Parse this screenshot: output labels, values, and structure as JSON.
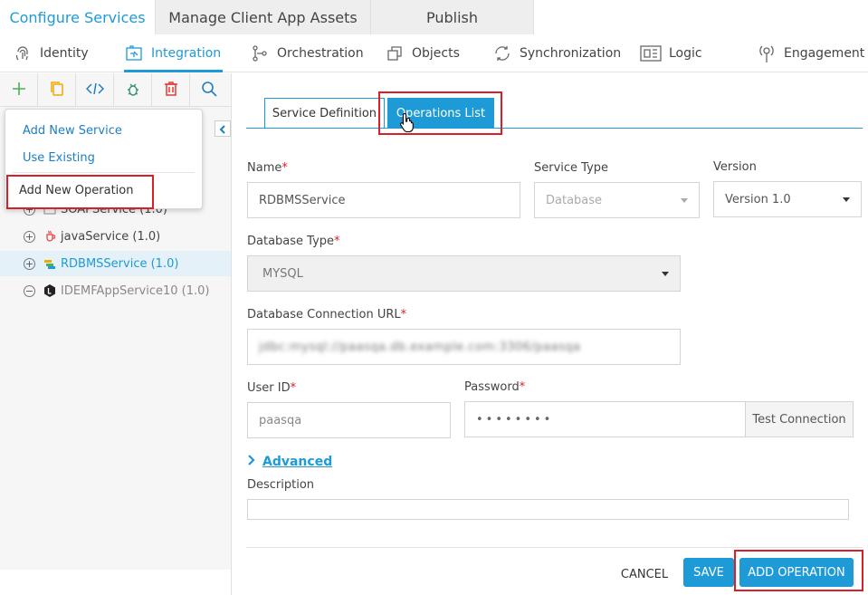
{
  "top_tabs": [
    {
      "label": "Configure Services"
    },
    {
      "label": "Manage Client App Assets"
    },
    {
      "label": "Publish"
    }
  ],
  "sub_nav": [
    {
      "label": "Identity",
      "icon": "fingerprint-icon"
    },
    {
      "label": "Integration",
      "icon": "integration-icon"
    },
    {
      "label": "Orchestration",
      "icon": "orchestration-icon"
    },
    {
      "label": "Objects",
      "icon": "objects-icon"
    },
    {
      "label": "Synchronization",
      "icon": "sync-icon"
    },
    {
      "label": "Logic",
      "icon": "logic-icon"
    },
    {
      "label": "Engagement",
      "icon": "engagement-icon"
    }
  ],
  "menu": {
    "add_new_service": "Add New Service",
    "use_existing": "Use Existing",
    "add_new_operation": "Add New Operation"
  },
  "tree": [
    {
      "label": "SOAPService (1.0)"
    },
    {
      "label": "javaService (1.0)"
    },
    {
      "label": "RDBMSService (1.0)"
    },
    {
      "label": "IDEMFAppService10 (1.0)"
    }
  ],
  "tabs": {
    "service_definition": "Service Definition",
    "operations_list": "Operations List"
  },
  "form": {
    "name_label": "Name",
    "name_value": "RDBMSService",
    "service_type_label": "Service Type",
    "service_type_value": "Database",
    "version_label": "Version",
    "version_value": "Version 1.0",
    "db_type_label": "Database Type",
    "db_type_value": "MYSQL",
    "db_url_label": "Database Connection URL",
    "db_url_value": "jdbc:mysql://paasqa.db.example.com:3306/paasqa",
    "user_id_label": "User ID",
    "user_id_value": "paasqa",
    "password_label": "Password",
    "password_value": "••••••••",
    "test_connection": "Test Connection",
    "advanced": "Advanced",
    "description_label": "Description",
    "description_value": ""
  },
  "footer": {
    "cancel": "CANCEL",
    "save": "SAVE",
    "add_operation": "ADD OPERATION"
  },
  "colors": {
    "accent": "#1e9ad6",
    "highlight": "#d9202a",
    "selected_row": "#e4f1f9"
  }
}
